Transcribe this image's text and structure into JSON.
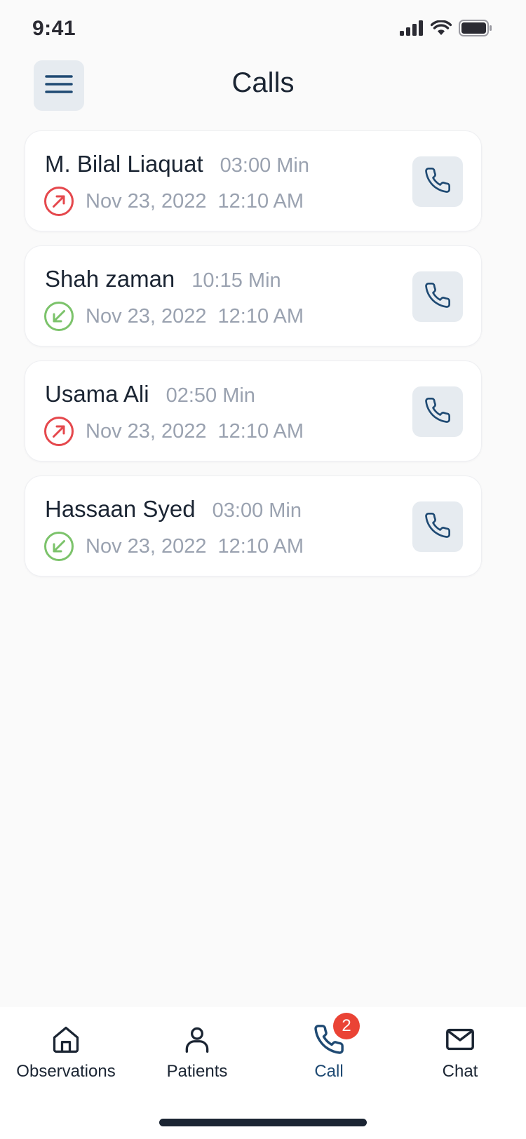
{
  "status_bar": {
    "time": "9:41",
    "icons": [
      "signal-icon",
      "wifi-icon",
      "battery-icon"
    ]
  },
  "header": {
    "title": "Calls",
    "menu_icon": "hamburger-menu-icon"
  },
  "calls": [
    {
      "name": "M. Bilal Liaquat",
      "duration": "03:00 Min",
      "direction": "outgoing",
      "date": "Nov 23, 2022",
      "time": "12:10 AM"
    },
    {
      "name": "Shah zaman",
      "duration": "10:15 Min",
      "direction": "incoming",
      "date": "Nov 23, 2022",
      "time": "12:10 AM"
    },
    {
      "name": "Usama Ali",
      "duration": "02:50 Min",
      "direction": "outgoing",
      "date": "Nov 23, 2022",
      "time": "12:10 AM"
    },
    {
      "name": "Hassaan Syed",
      "duration": "03:00 Min",
      "direction": "incoming",
      "date": "Nov 23, 2022",
      "time": "12:10 AM"
    }
  ],
  "bottom_nav": {
    "items": [
      {
        "label": "Observations",
        "icon": "home-icon"
      },
      {
        "label": "Patients",
        "icon": "person-icon"
      },
      {
        "label": "Call",
        "icon": "phone-icon",
        "badge": "2",
        "active": true
      },
      {
        "label": "Chat",
        "icon": "mail-icon"
      }
    ]
  },
  "colors": {
    "outgoing": "#e5484d",
    "incoming": "#7cc36b",
    "accent": "#1f4a73",
    "badge": "#ea4335"
  }
}
